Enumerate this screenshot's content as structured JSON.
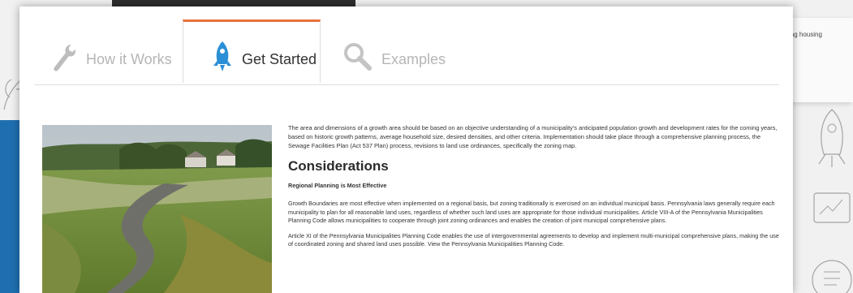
{
  "background": {
    "right_snippet": "ing housing",
    "accent_blue": "#1f6fb0"
  },
  "tabs": [
    {
      "label": "How it Works",
      "icon": "wrench-icon",
      "active": false
    },
    {
      "label": "Get Started",
      "icon": "rocket-icon",
      "active": true
    },
    {
      "label": "Examples",
      "icon": "magnifier-icon",
      "active": false
    }
  ],
  "accent_color": "#e9703c",
  "content": {
    "intro": "The area and dimensions of a growth area should be based on an objective understanding of a municipality's anticipated population growth and development rates for the coming years, based on historic growth patterns, average household size, desired densities, and other criteria. Implementation should take place through a comprehensive planning process, the Sewage Facilities Plan (Act 537 Plan) process, revisions to land use ordinances, specifically the zoning map.",
    "heading": "Considerations",
    "subheading": "Regional Planning is Most Effective",
    "para1": "Growth Boundaries are most effective when implemented on a regional basis, but zoning traditionally is exercised on an individual municipal basis. Pennsylvania laws generally require each municipality to plan for all reasonable land uses, regardless of whether such land uses are appropriate for those individual municipalities. Article VIII-A of the Pennsylvania Municipalities Planning Code allows municipalities to cooperate through joint zoning ordinances and enables the creation of joint municipal comprehensive plans.",
    "para2": "Article XI of the Pennsylvania Municipalities Planning Code enables the use of intergovernmental agreements to develop and implement multi-municipal comprehensive plans, making the use of coordinated zoning and shared land uses possible. View the Pennsylvania Municipalities Planning Code."
  }
}
